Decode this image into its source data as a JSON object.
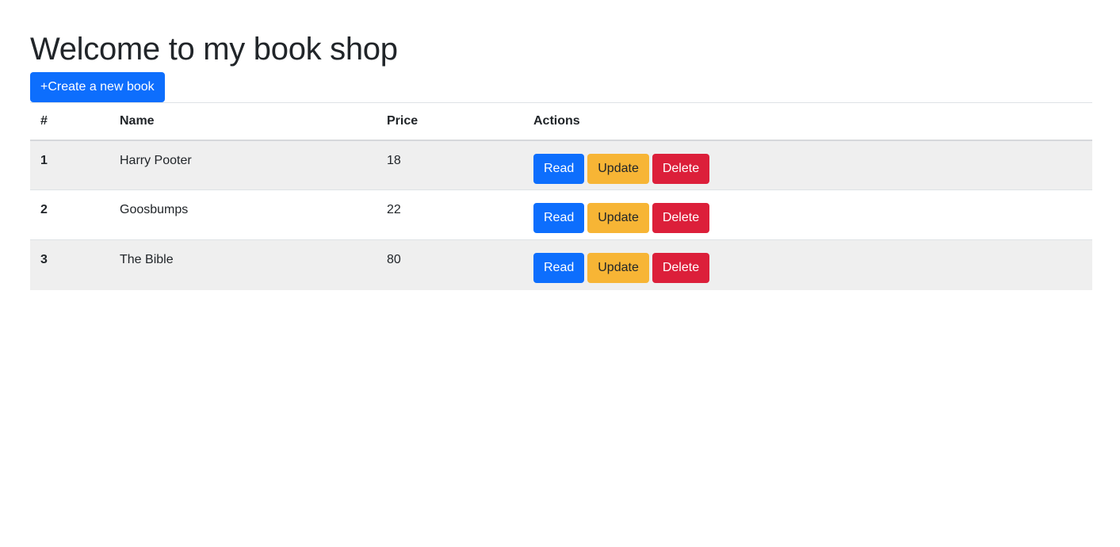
{
  "page": {
    "title": "Welcome to my book shop"
  },
  "toolbar": {
    "create_label": "+Create a new book"
  },
  "table": {
    "headers": [
      "#",
      "Name",
      "Price",
      "Actions"
    ],
    "rows": [
      {
        "id": "1",
        "name": "Harry Pooter",
        "price": "18"
      },
      {
        "id": "2",
        "name": "Goosbumps",
        "price": "22"
      },
      {
        "id": "3",
        "name": "The Bible",
        "price": "80"
      }
    ]
  },
  "actions": {
    "read_label": "Read",
    "update_label": "Update",
    "delete_label": "Delete"
  },
  "colors": {
    "primary": "#0d6efd",
    "warning": "#f7b535",
    "danger": "#dc1f3a",
    "stripe": "#efefef"
  }
}
